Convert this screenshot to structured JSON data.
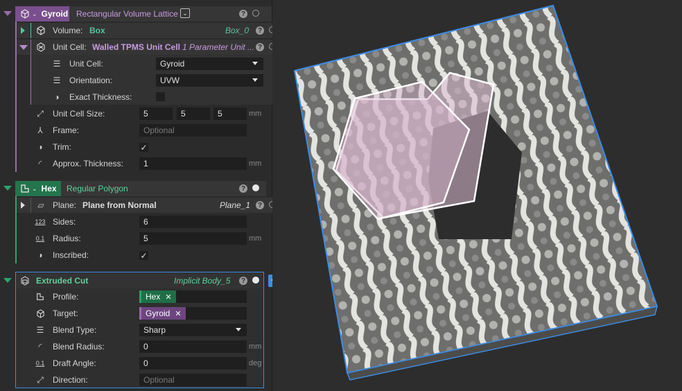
{
  "colors": {
    "gyroid_purple": "#9b6bb0",
    "hex_green": "#2ea36b",
    "cut_blue": "#3c8ce6",
    "volume_green": "#5cc0a0",
    "link_purple": "#c89ae0"
  },
  "gyroid": {
    "name": "Gyroid",
    "type": "Rectangular Volume Lattice",
    "volume": {
      "label": "Volume:",
      "value": "Box",
      "ref": "Box_0"
    },
    "unit_cell": {
      "label": "Unit Cell:",
      "value": "Walled TPMS Unit Cell",
      "ref": "1 Parameter Unit ...",
      "fields": {
        "cell_label": "Unit Cell:",
        "cell_value": "Gyroid",
        "orientation_label": "Orientation:",
        "orientation_value": "UVW",
        "exact_label": "Exact Thickness:"
      }
    },
    "unit_cell_size": {
      "label": "Unit Cell Size:",
      "x": "5",
      "y": "5",
      "z": "5",
      "unit": "mm"
    },
    "frame": {
      "label": "Frame:",
      "placeholder": "Optional"
    },
    "trim": {
      "label": "Trim:",
      "check": "✓"
    },
    "approx": {
      "label": "Approx. Thickness:",
      "value": "1",
      "unit": "mm"
    }
  },
  "hex": {
    "name": "Hex",
    "type": "Regular Polygon",
    "plane": {
      "label": "Plane:",
      "value": "Plane from Normal",
      "ref": "Plane_1"
    },
    "sides": {
      "label": "Sides:",
      "value": "6"
    },
    "radius": {
      "label": "Radius:",
      "value": "5",
      "unit": "mm"
    },
    "inscribed": {
      "label": "Inscribed:",
      "check": "✓"
    }
  },
  "cut": {
    "name": "Extruded Cut",
    "ref": "Implicit Body_5",
    "profile": {
      "label": "Profile:",
      "tag": "Hex"
    },
    "target": {
      "label": "Target:",
      "tag": "Gyroid"
    },
    "blend_type": {
      "label": "Blend Type:",
      "value": "Sharp"
    },
    "blend_radius": {
      "label": "Blend Radius:",
      "value": "0",
      "unit": "mm"
    },
    "draft_angle": {
      "label": "Draft Angle:",
      "value": "0",
      "unit": "deg"
    },
    "direction": {
      "label": "Direction:",
      "placeholder": "Optional"
    }
  },
  "icons": {
    "help": "?",
    "add": "+",
    "remove": "✕",
    "sides_icon_text": "123",
    "radius_icon_text": "0.1",
    "draft_icon_text": "0.1"
  }
}
